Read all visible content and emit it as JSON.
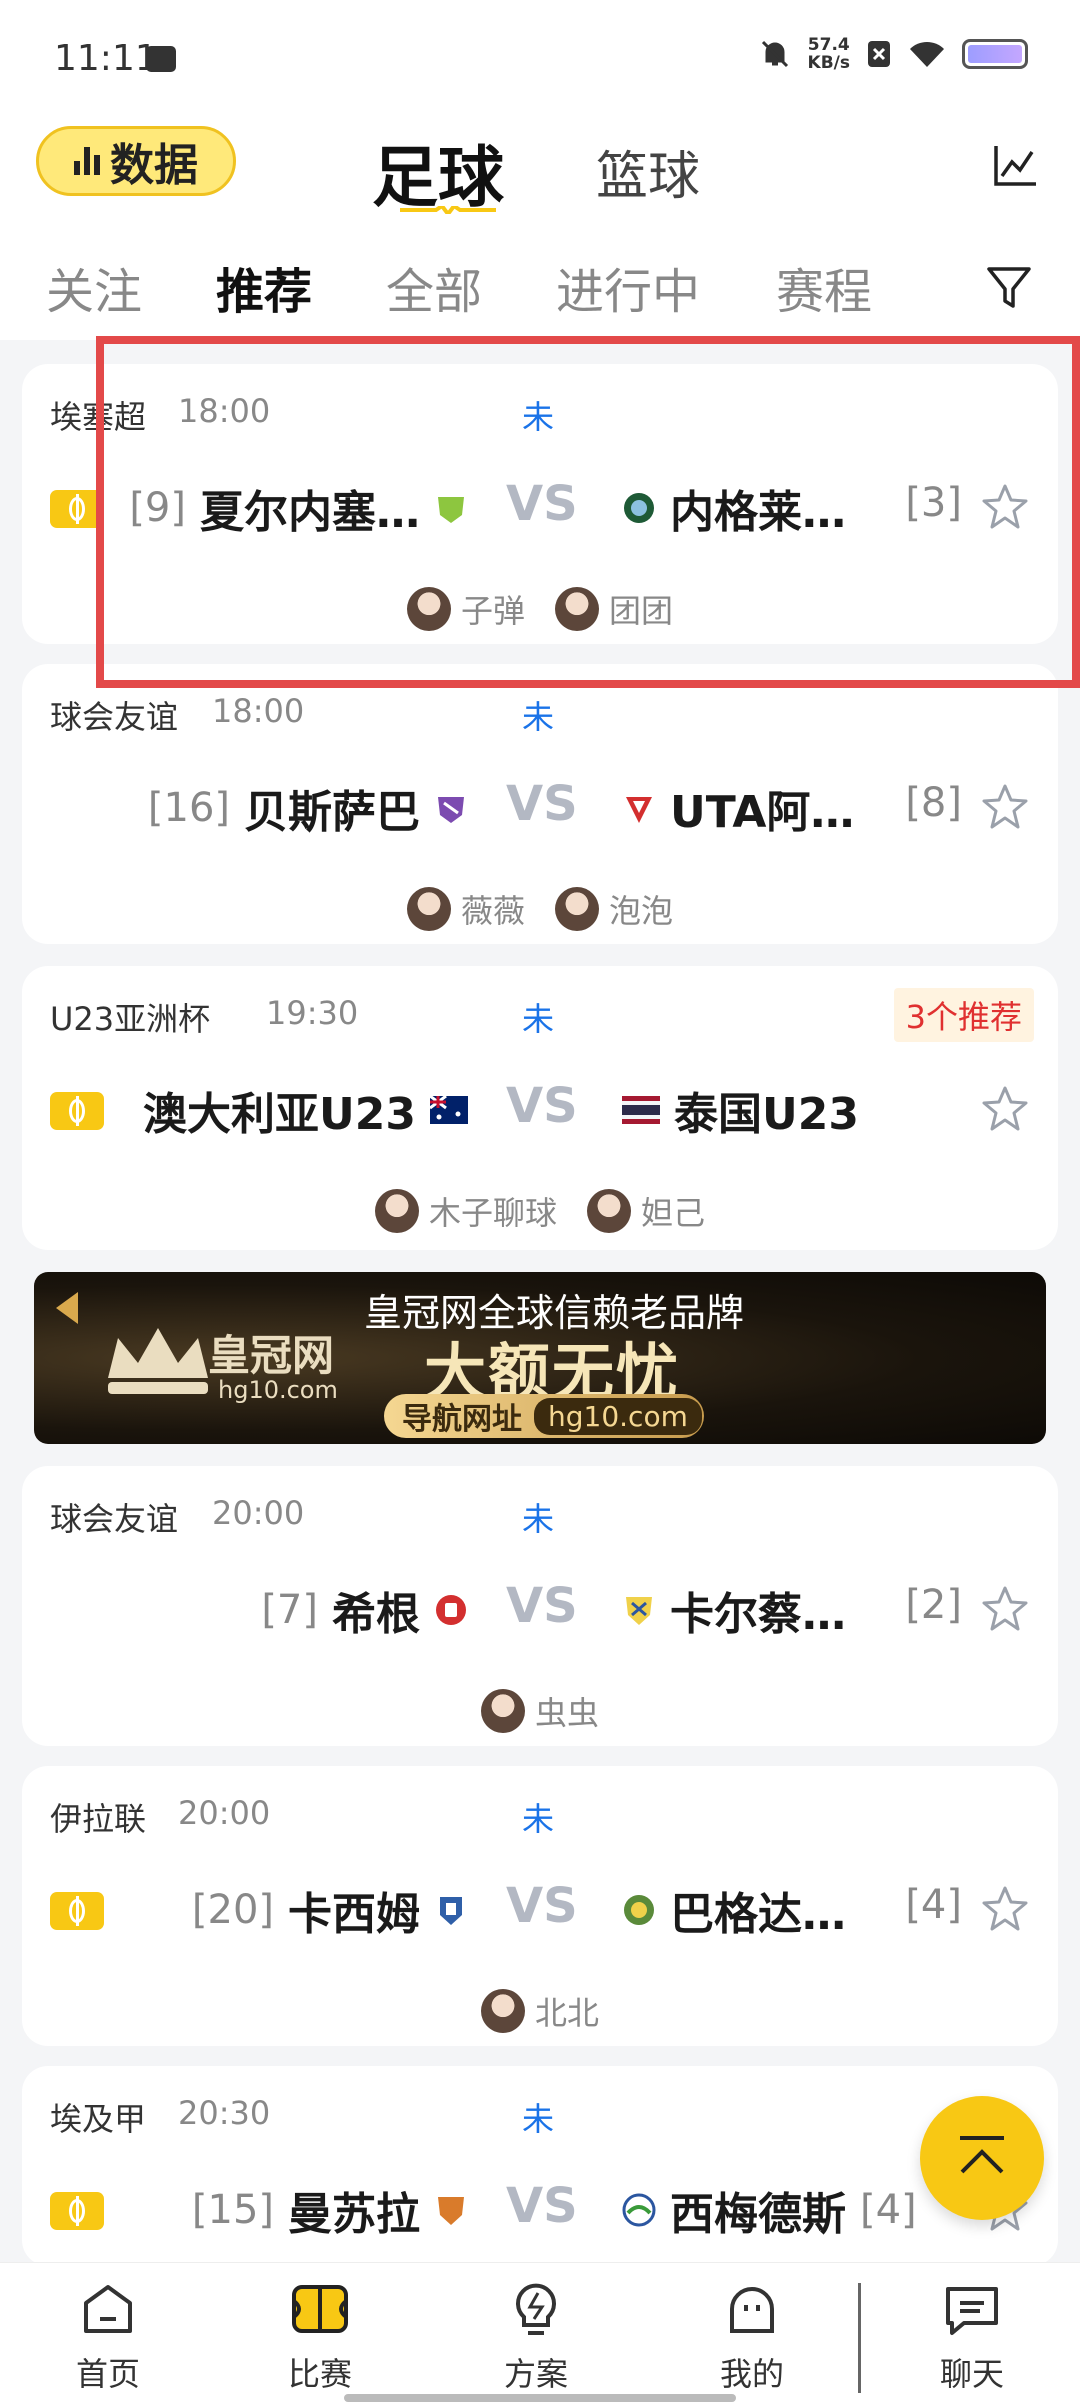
{
  "status_bar": {
    "time": "11:11",
    "speed_value": "57.4",
    "speed_unit": "KB/s"
  },
  "header": {
    "data_button_label": "数据",
    "title_active": "足球",
    "title_inactive": "篮球"
  },
  "tabs": [
    "关注",
    "推荐",
    "全部",
    "进行中",
    "赛程"
  ],
  "active_tab": "推荐",
  "matches": [
    {
      "league": "埃塞超",
      "time": "18:00",
      "status": "未",
      "home_rank": "[9]",
      "home_team": "夏尔内塞…",
      "vs": "VS",
      "away_team": "内格莱…",
      "away_rank": "[3]",
      "experts": [
        "子弹",
        "团团"
      ]
    },
    {
      "league": "球会友谊",
      "time": "18:00",
      "status": "未",
      "home_rank": "[16]",
      "home_team": "贝斯萨巴",
      "vs": "VS",
      "away_team": "UTA阿…",
      "away_rank": "[8]",
      "experts": [
        "薇薇",
        "泡泡"
      ]
    },
    {
      "league": "U23亚洲杯",
      "time": "19:30",
      "status": "未",
      "badge": "3个推荐",
      "home_team": "澳大利亚U23",
      "vs": "VS",
      "away_team": "泰国U23",
      "experts": [
        "木子聊球",
        "妲己"
      ]
    },
    {
      "league": "球会友谊",
      "time": "20:00",
      "status": "未",
      "home_rank": "[7]",
      "home_team": "希根",
      "vs": "VS",
      "away_team": "卡尔蔡…",
      "away_rank": "[2]",
      "experts": [
        "虫虫"
      ]
    },
    {
      "league": "伊拉联",
      "time": "20:00",
      "status": "未",
      "home_rank": "[20]",
      "home_team": "卡西姆",
      "vs": "VS",
      "away_team": "巴格达…",
      "away_rank": "[4]",
      "experts": [
        "北北"
      ]
    },
    {
      "league": "埃及甲",
      "time": "20:30",
      "status": "未",
      "home_rank": "[15]",
      "home_team": "曼苏拉",
      "vs": "VS",
      "away_team": "西梅德斯",
      "away_rank": "[4]"
    }
  ],
  "banner": {
    "slogan": "皇冠网全球信赖老品牌",
    "headline": "大额无忧",
    "brand": "皇冠网",
    "brand_url": "hg10.com",
    "nav_label": "导航网址",
    "nav_url": "hg10.com"
  },
  "bottom_nav": [
    "首页",
    "比赛",
    "方案",
    "我的",
    "聊天"
  ],
  "colors": {
    "accent_yellow": "#f8c814",
    "status_blue": "#1a73e8",
    "badge_red": "#e03030",
    "highlight_red": "#e34949"
  }
}
